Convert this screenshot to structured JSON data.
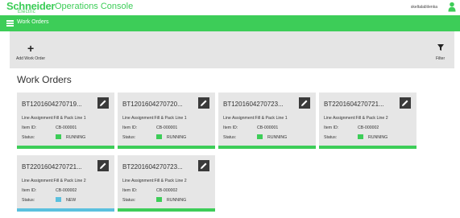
{
  "header": {
    "logo_text": "Schneider",
    "logo_subtext": "Electric",
    "app_title": "Operations Console",
    "user_name": "skeltalab\\lenka"
  },
  "nav": {
    "title": "Work Orders"
  },
  "toolbar": {
    "add_label": "Add Work Order",
    "filter_label": "Filter"
  },
  "main": {
    "page_title": "Work Orders"
  },
  "labels": {
    "line_assignment": "Line Assignment:",
    "item_id": "Item ID:",
    "status": "Status:"
  },
  "colors": {
    "brand_green": "#3dcd58",
    "status_running": "#3dcd58",
    "status_new": "#5bc0de"
  },
  "work_orders": [
    {
      "id": "BT1201604270719...",
      "line": "Fill & Pack Line 1",
      "item_id": "CB-000001",
      "status": "RUNNING"
    },
    {
      "id": "BT1201604270720...",
      "line": "Fill & Pack Line 1",
      "item_id": "CB-000001",
      "status": "RUNNING"
    },
    {
      "id": "BT1201604270723...",
      "line": "Fill & Pack Line 1",
      "item_id": "CB-000001",
      "status": "RUNNING"
    },
    {
      "id": "BT2201604270721...",
      "line": "Fill & Pack Line 2",
      "item_id": "CB-000002",
      "status": "RUNNING"
    },
    {
      "id": "BT2201604270721...",
      "line": "Fill & Pack Line 2",
      "item_id": "CB-000002",
      "status": "NEW"
    },
    {
      "id": "BT2201604270723...",
      "line": "Fill & Pack Line 2",
      "item_id": "CB-000002",
      "status": "RUNNING"
    }
  ]
}
